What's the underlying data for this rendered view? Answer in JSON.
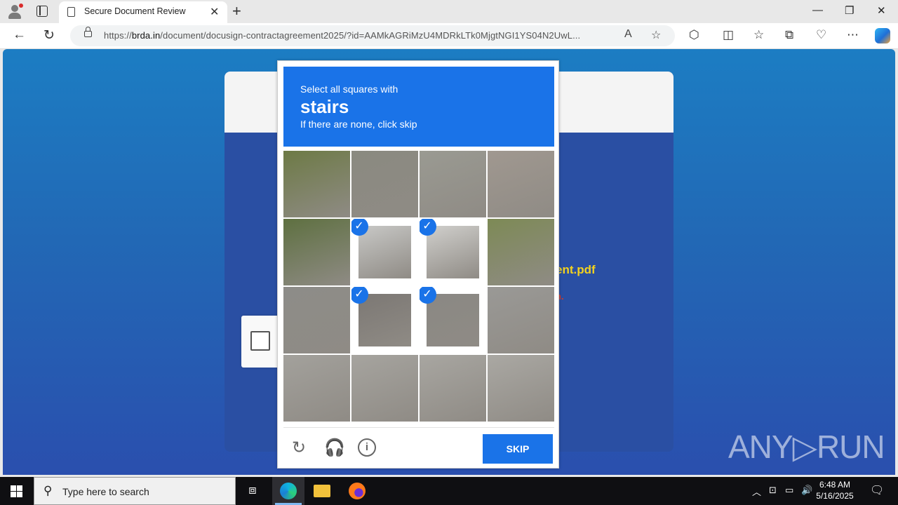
{
  "browser": {
    "tab_title": "Secure Document Review",
    "url_domain": "brda.in",
    "url_prefix": "https://",
    "url_rest": "/document/docusign-contractagreement2025/?id=AAMkAGRiMzU4MDRkLTk0MjgtNGI1YS04N2UwL..."
  },
  "page": {
    "filename_fragment": "ent.pdf",
    "red_fragment": "n.",
    "watermark": "ANY▷RUN"
  },
  "captcha": {
    "instruction_line1": "Select all squares with",
    "target": "stairs",
    "instruction_line3": "If there are none, click skip",
    "skip_label": "SKIP",
    "selected_tiles": [
      5,
      6,
      9,
      10
    ]
  },
  "taskbar": {
    "search_placeholder": "Type here to search",
    "time": "6:48 AM",
    "date": "5/16/2025"
  }
}
